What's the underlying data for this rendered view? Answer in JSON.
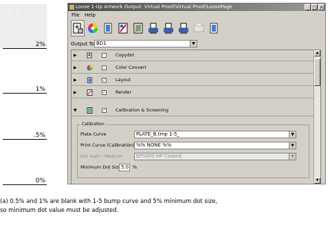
{
  "scale": {
    "labels": [
      "2%",
      "1%",
      ".5%",
      "0%"
    ]
  },
  "window": {
    "title": "Loose 1-Up Artwork Output: Virtual Proof/Virtual Proof/LoosePage",
    "buttons": {
      "minimize": "_",
      "maximize": "□",
      "close": "×"
    }
  },
  "menu": {
    "file": "File",
    "help": "Help"
  },
  "output": {
    "label": "Output To:",
    "value": "BD1"
  },
  "sections": [
    {
      "title": "Copydot",
      "expanded": false
    },
    {
      "title": "Color Convert",
      "expanded": false
    },
    {
      "title": "Layout",
      "expanded": false
    },
    {
      "title": "Render",
      "expanded": false
    },
    {
      "title": "Calibration & Screening",
      "expanded": true
    }
  ],
  "calibration": {
    "group_label": "Calibration",
    "plate_curve": {
      "label": "Plate Curve",
      "value": "PLATE_B.tmp 1-5_"
    },
    "print_curve": {
      "label": "Print Curve (Calibration):",
      "value": "%% NONE %%"
    },
    "dot_gain": {
      "label": "Dot Gain / Medium",
      "value": "EPS000-HP Coated"
    },
    "min_dot": {
      "label": "Minimum Dot Size",
      "value": "5.0",
      "unit": "%"
    }
  },
  "caption": {
    "line1": "(a) 0.5% and 1% are blank with 1-5 bump curve and 5% minimum dot size,",
    "line2": "so minimum dot value must be adjusted."
  },
  "colors": {
    "titlebar": "#4a4a4a",
    "window_bg": "#d4d0c8"
  }
}
